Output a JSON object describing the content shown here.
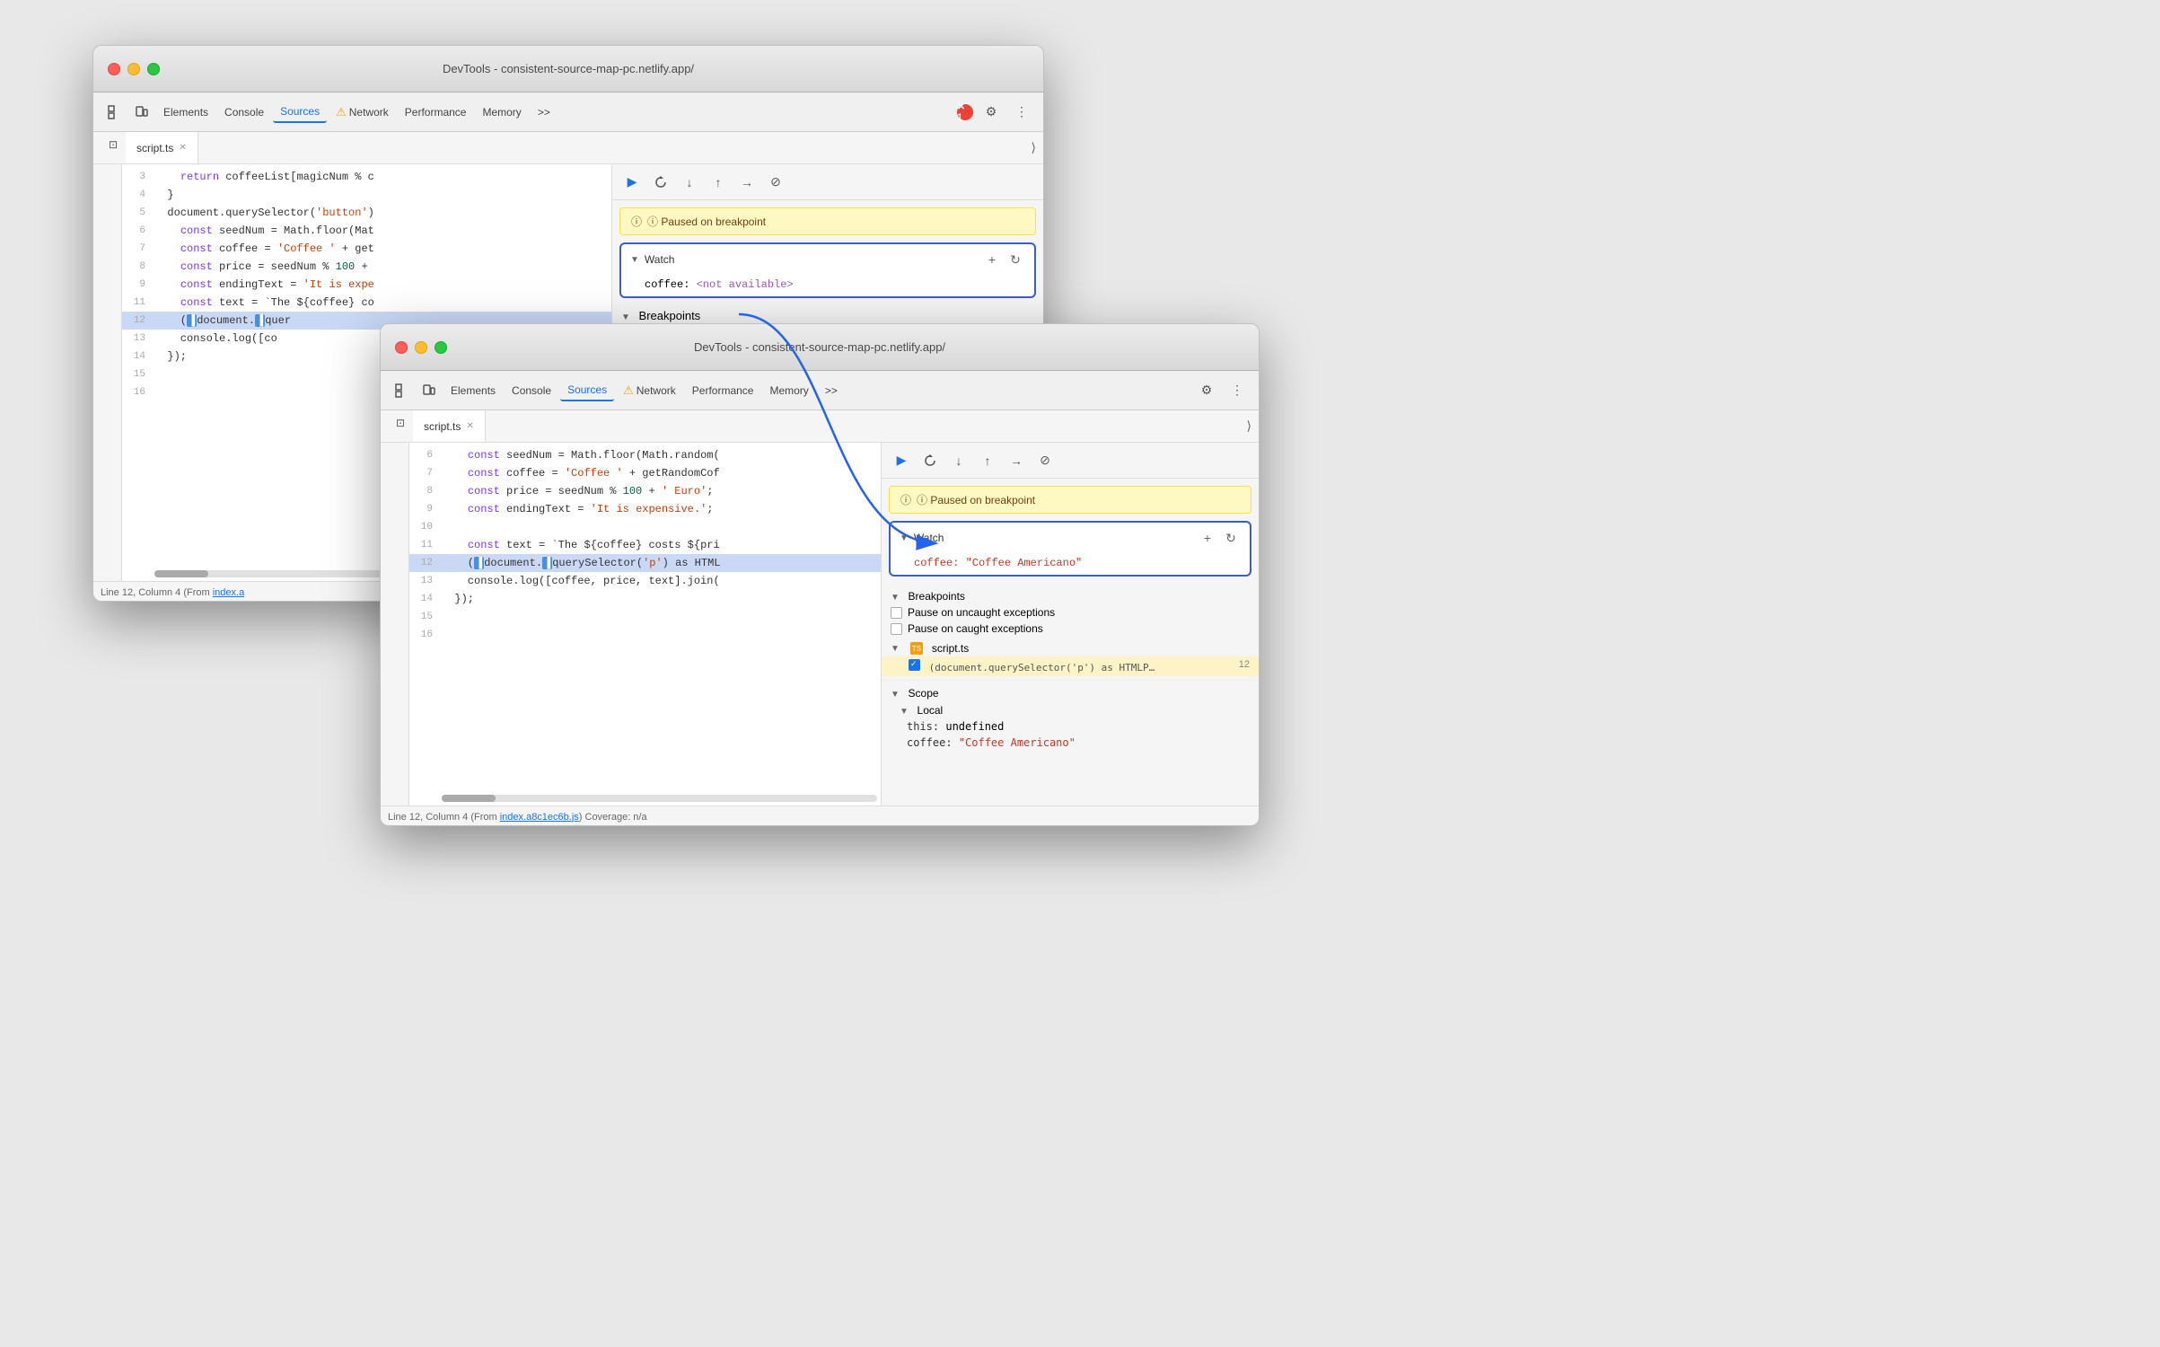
{
  "scene": {
    "background": "#e5e5e5"
  },
  "window_back": {
    "title": "DevTools - consistent-source-map-pc.netlify.app/",
    "traffic_lights": [
      "red",
      "yellow",
      "green"
    ],
    "toolbar": {
      "tabs": [
        "Elements",
        "Console",
        "Sources",
        "Network",
        "Performance",
        "Memory"
      ],
      "active_tab": "Sources",
      "more_btn": ">>",
      "error_count": "1"
    },
    "file_tabs": [
      {
        "label": "script.ts",
        "active": true
      }
    ],
    "code": {
      "lines": [
        {
          "num": "3",
          "content": "    return coffeeList[magicNum % c"
        },
        {
          "num": "4",
          "content": "  }"
        },
        {
          "num": "5",
          "content": "  document.querySelector('button')"
        },
        {
          "num": "6",
          "content": "    const seedNum = Math.floor(Mat"
        },
        {
          "num": "7",
          "content": "    const coffee = 'Coffee ' + get"
        },
        {
          "num": "8",
          "content": "    const price = seedNum % 100 +"
        },
        {
          "num": "9",
          "content": "    const endingText = 'It is expe"
        },
        {
          "num": "11",
          "content": "    const text = `The ${coffee} co"
        },
        {
          "num": "12",
          "content": "    (document.querySelector",
          "highlight": "blue"
        },
        {
          "num": "13",
          "content": "    console.log([co"
        },
        {
          "num": "14",
          "content": "  });"
        },
        {
          "num": "15",
          "content": ""
        },
        {
          "num": "16",
          "content": ""
        }
      ]
    },
    "right_panel": {
      "paused_banner": "ⓘ Paused on breakpoint",
      "watch": {
        "title": "Watch",
        "entry": "coffee: <not available>",
        "entry_key": "coffee: ",
        "entry_val": "<not available>"
      },
      "breakpoints": {
        "title": "Breakpoints"
      }
    },
    "status_bar": "Line 12, Column 4  (From index.a"
  },
  "window_front": {
    "title": "DevTools - consistent-source-map-pc.netlify.app/",
    "traffic_lights": [
      "red",
      "yellow",
      "green"
    ],
    "toolbar": {
      "tabs": [
        "Elements",
        "Console",
        "Sources",
        "Network",
        "Performance",
        "Memory"
      ],
      "active_tab": "Sources",
      "more_btn": ">>",
      "warning": "⚠"
    },
    "file_tabs": [
      {
        "label": "script.ts",
        "active": true
      }
    ],
    "code": {
      "lines": [
        {
          "num": "6",
          "content": "    const seedNum = Math.floor(Math.random("
        },
        {
          "num": "7",
          "content": "    const coffee = 'Coffee ' + getRandomCof"
        },
        {
          "num": "8",
          "content": "    const price = seedNum % 100 + ' Euro';"
        },
        {
          "num": "9",
          "content": "    const endingText = 'It is expensive.';"
        },
        {
          "num": "10",
          "content": ""
        },
        {
          "num": "11",
          "content": "    const text = `The ${coffee} costs ${pri"
        },
        {
          "num": "12",
          "content": "    (document.querySelector('p') as HTML",
          "highlight": "blue"
        },
        {
          "num": "13",
          "content": "    console.log([coffee, price, text].join("
        },
        {
          "num": "14",
          "content": "  });"
        },
        {
          "num": "15",
          "content": ""
        },
        {
          "num": "16",
          "content": ""
        }
      ]
    },
    "right_panel": {
      "paused_banner": "ⓘ Paused on breakpoint",
      "watch": {
        "title": "Watch",
        "entry_key": "coffee: ",
        "entry_val": "\"Coffee Americano\""
      },
      "breakpoints": {
        "title": "Breakpoints",
        "items": [
          {
            "label": "Pause on uncaught exceptions"
          },
          {
            "label": "Pause on caught exceptions"
          }
        ],
        "script_file": "script.ts",
        "bp_code": "(document.querySelector('p') as HTMLP…",
        "bp_line": "12"
      },
      "scope": {
        "title": "Scope",
        "local_title": "Local",
        "items": [
          {
            "key": "this:",
            "val": "undefined"
          },
          {
            "key": "coffee:",
            "val": "\"Coffee Americano\""
          }
        ]
      }
    },
    "status_bar": "Line 12, Column 4  (From index.a8c1ec6b.js) Coverage: n/a"
  },
  "arrow": {
    "label": "arrow from Watch(back) to Watch(front)"
  },
  "icons": {
    "play": "▶",
    "step_over": "↷",
    "step_into": "↓",
    "step_out": "↑",
    "continue": "→",
    "deactivate": "⊘",
    "refresh": "↻",
    "add": "+",
    "settings": "⚙",
    "more": "⋮",
    "triangle_right": "▶",
    "triangle_down": "▼",
    "expand": "⟩",
    "collapse_panel": "⟨⟩",
    "file_navigator": "⊡"
  }
}
